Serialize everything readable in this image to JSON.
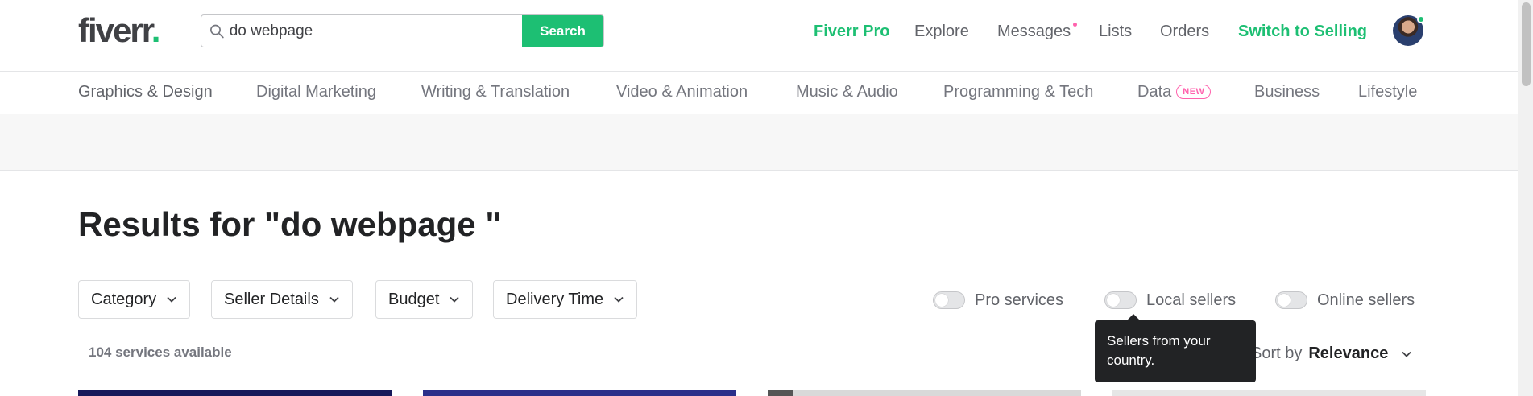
{
  "header": {
    "logo_text": "fiverr",
    "logo_dot": ".",
    "search": {
      "value": "do webpage",
      "button_label": "Search"
    },
    "nav": {
      "fiverr_pro": "Fiverr Pro",
      "explore": "Explore",
      "messages": "Messages",
      "lists": "Lists",
      "orders": "Orders",
      "switch_selling": "Switch to Selling"
    },
    "accent_color": "#1dbf73",
    "notification_color": "#ff62ad"
  },
  "categories": [
    "Graphics & Design",
    "Digital Marketing",
    "Writing & Translation",
    "Video & Animation",
    "Music & Audio",
    "Programming & Tech",
    "Data",
    "Business",
    "Lifestyle"
  ],
  "new_badge": "NEW",
  "results": {
    "title": "Results for \"do webpage \"",
    "filters": [
      "Category",
      "Seller Details",
      "Budget",
      "Delivery Time"
    ],
    "toggles": [
      "Pro services",
      "Local sellers",
      "Online sellers"
    ],
    "count": "104 services available",
    "sort_label": "Sort by",
    "sort_value": "Relevance",
    "tooltip": "Sellers from your country."
  }
}
